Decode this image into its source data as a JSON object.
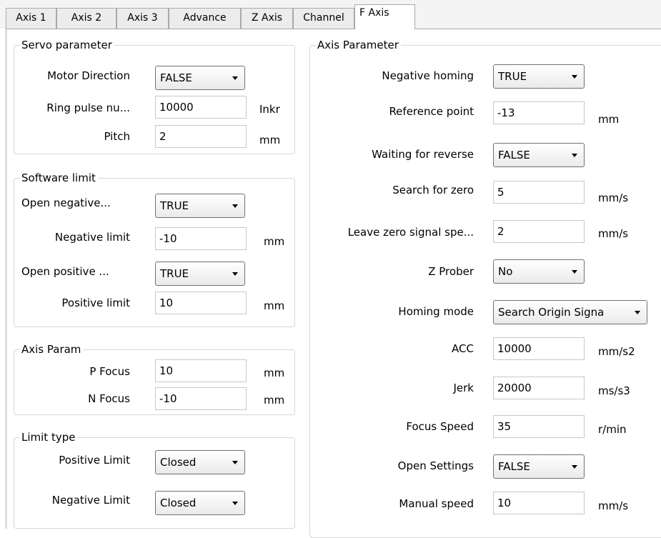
{
  "tabs": [
    {
      "label": "Axis 1"
    },
    {
      "label": "Axis 2"
    },
    {
      "label": "Axis 3"
    },
    {
      "label": "Advance"
    },
    {
      "label": "Z Axis"
    },
    {
      "label": "Channel"
    },
    {
      "label": "F Axis"
    }
  ],
  "active_tab": "F Axis",
  "servo": {
    "title": "Servo parameter",
    "motor_direction": {
      "label": "Motor Direction",
      "value": "FALSE"
    },
    "ring_pulse": {
      "label": "Ring pulse nu...",
      "value": "10000",
      "unit": "Inkr"
    },
    "pitch": {
      "label": "Pitch",
      "value": "2",
      "unit": "mm"
    }
  },
  "software_limit": {
    "title": "Software limit",
    "open_negative": {
      "label": "Open negative...",
      "value": "TRUE"
    },
    "negative_limit": {
      "label": "Negative limit",
      "value": "-10",
      "unit": "mm"
    },
    "open_positive": {
      "label": "Open positive ...",
      "value": "TRUE"
    },
    "positive_limit": {
      "label": "Positive limit",
      "value": "10",
      "unit": "mm"
    }
  },
  "axis_param": {
    "title": "Axis Param",
    "p_focus": {
      "label": "P Focus",
      "value": "10",
      "unit": "mm"
    },
    "n_focus": {
      "label": "N Focus",
      "value": "-10",
      "unit": "mm"
    }
  },
  "limit_type": {
    "title": "Limit type",
    "positive": {
      "label": "Positive Limit",
      "value": "Closed"
    },
    "negative": {
      "label": "Negative Limit",
      "value": "Closed"
    }
  },
  "axis_parameter": {
    "title": "Axis Parameter",
    "negative_homing": {
      "label": "Negative homing",
      "value": "TRUE"
    },
    "reference_point": {
      "label": "Reference point",
      "value": "-13",
      "unit": "mm"
    },
    "waiting_reverse": {
      "label": "Waiting for reverse",
      "value": "FALSE"
    },
    "search_zero": {
      "label": "Search for zero",
      "value": "5",
      "unit": "mm/s"
    },
    "leave_zero": {
      "label": "Leave zero signal spe...",
      "value": "2",
      "unit": "mm/s"
    },
    "z_prober": {
      "label": "Z Prober",
      "value": "No"
    },
    "homing_mode": {
      "label": "Homing mode",
      "value": "Search Origin Signa"
    },
    "acc": {
      "label": "ACC",
      "value": "10000",
      "unit": "mm/s2"
    },
    "jerk": {
      "label": "Jerk",
      "value": "20000",
      "unit": "ms/s3"
    },
    "focus_speed": {
      "label": "Focus Speed",
      "value": "35",
      "unit": "r/min"
    },
    "open_settings": {
      "label": "Open Settings",
      "value": "FALSE"
    },
    "manual_speed": {
      "label": "Manual speed",
      "value": "10",
      "unit": "mm/s"
    }
  }
}
